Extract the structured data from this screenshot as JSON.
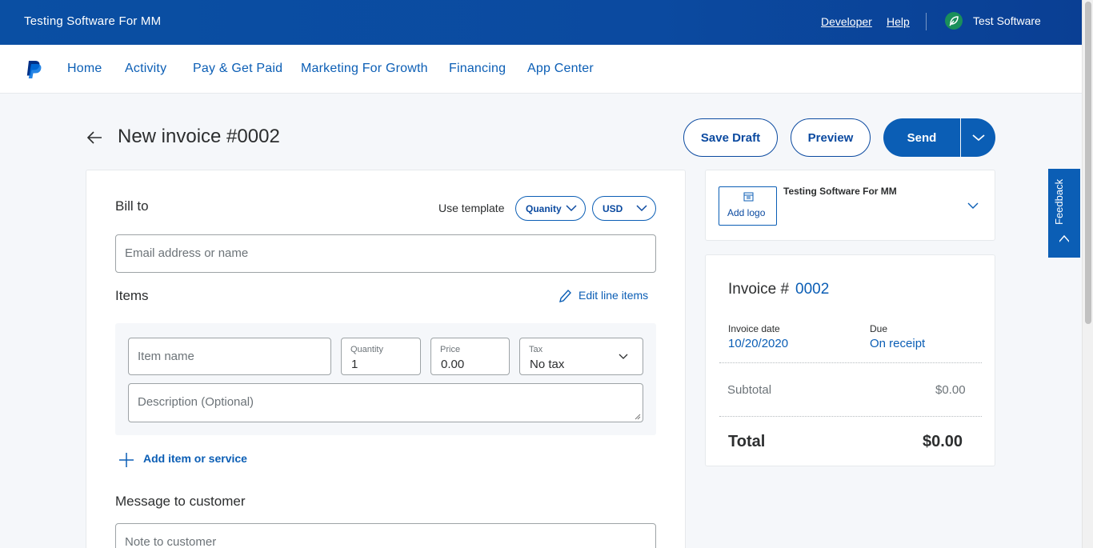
{
  "topbar": {
    "business_name": "Testing Software For MM",
    "developer_link": "Developer",
    "help_link": "Help",
    "user_name": "Test Software"
  },
  "nav": {
    "items": [
      "Home",
      "Activity",
      "Pay & Get Paid",
      "Marketing For Growth",
      "Financing",
      "App Center"
    ]
  },
  "page": {
    "title": "New invoice #0002",
    "save_draft": "Save Draft",
    "preview": "Preview",
    "send": "Send"
  },
  "form": {
    "bill_to_heading": "Bill to",
    "use_template_label": "Use template",
    "template_value": "Quanity",
    "currency_value": "USD",
    "email_placeholder": "Email address or name",
    "items_heading": "Items",
    "edit_line_items": "Edit line items",
    "item_name_placeholder": "Item name",
    "quantity_label": "Quantity",
    "quantity_value": "1",
    "price_label": "Price",
    "price_value": "0.00",
    "tax_label": "Tax",
    "tax_value": "No tax",
    "description_placeholder": "Description (Optional)",
    "add_item": "Add item or service",
    "message_heading": "Message to customer",
    "note_placeholder": "Note to customer"
  },
  "business_card": {
    "add_logo": "Add logo",
    "name": "Testing Software For MM"
  },
  "summary": {
    "invoice_label": "Invoice #",
    "invoice_number": "0002",
    "invoice_date_label": "Invoice date",
    "invoice_date": "10/20/2020",
    "due_label": "Due",
    "due_value": "On receipt",
    "subtotal_label": "Subtotal",
    "subtotal_value": "$0.00",
    "total_label": "Total",
    "total_value": "$0.00"
  },
  "feedback": {
    "label": "Feedback"
  },
  "colors": {
    "brand_blue": "#0b5eb5",
    "header_blue": "#0a4fa3"
  }
}
